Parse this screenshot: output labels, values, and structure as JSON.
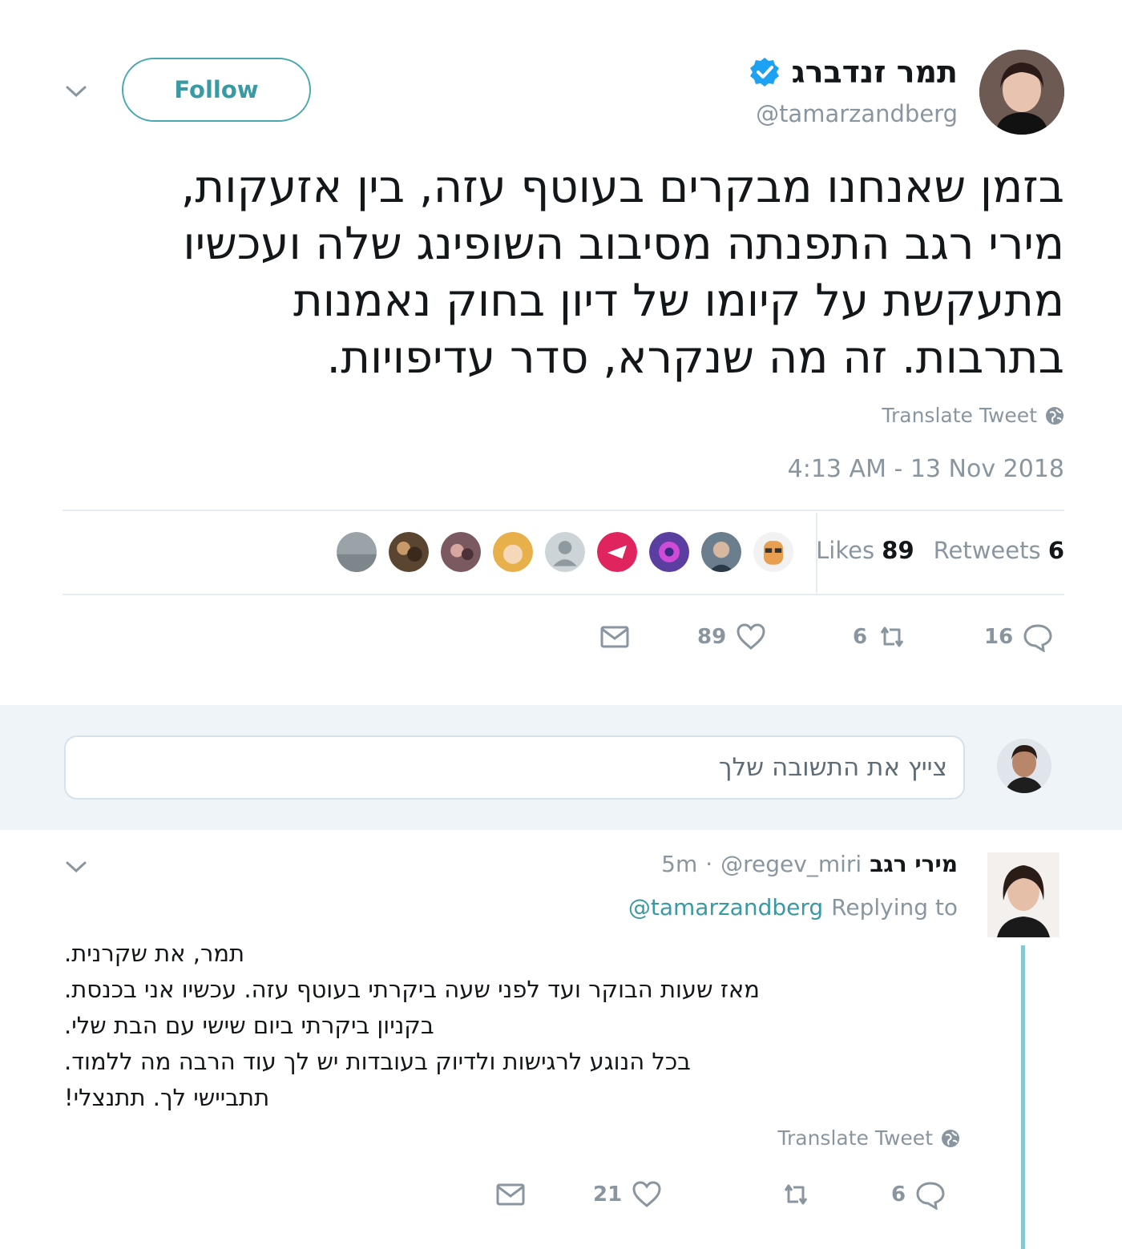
{
  "tweet": {
    "author_name": "תמר זנדברג",
    "author_handle": "@tamarzandberg",
    "follow_label": "Follow",
    "text_lines": [
      "בזמן שאנחנו מבקרים בעוטף עזה, בין אזעקות,",
      "מירי רגב התפנתה מסיבוב השופינג שלה ועכשיו",
      "מתעקשת על קיומו של דיון בחוק נאמנות",
      "בתרבות. זה מה שנקרא, סדר עדיפויות."
    ],
    "translate_label": "Translate Tweet",
    "timestamp": "4:13 AM - 13 Nov 2018",
    "retweets_label": "Retweets",
    "retweets_count": "6",
    "likes_label": "Likes",
    "likes_count": "89",
    "actions": {
      "replies": "16",
      "retweets": "6",
      "likes": "89"
    }
  },
  "reply_box": {
    "placeholder": "צייץ את התשובה שלך"
  },
  "reply": {
    "author_name": "מירי רגב",
    "author_handle": "@regev_miri",
    "time": "5m",
    "separator": "·",
    "replying_to_label": "Replying to",
    "replying_to_handle": "@tamarzandberg",
    "text_lines": [
      "תמר, את שקרנית.",
      "מאז שעות הבוקר ועד לפני שעה ביקרתי בעוטף עזה. עכשיו אני בכנסת.",
      "בקניון ביקרתי ביום שישי עם הבת שלי.",
      "בכל הנוגע לרגישות ולדיוק בעובדות יש לך עוד הרבה מה ללמוד.",
      "תתביישי לך. תתנצלי!"
    ],
    "translate_label": "Translate Tweet",
    "actions": {
      "replies": "6",
      "retweets": "",
      "likes": "21"
    }
  },
  "colors": {
    "accent": "#3a9aa3",
    "verified": "#1da1f2",
    "muted": "#8a969f",
    "like_red": "#e0245e"
  }
}
